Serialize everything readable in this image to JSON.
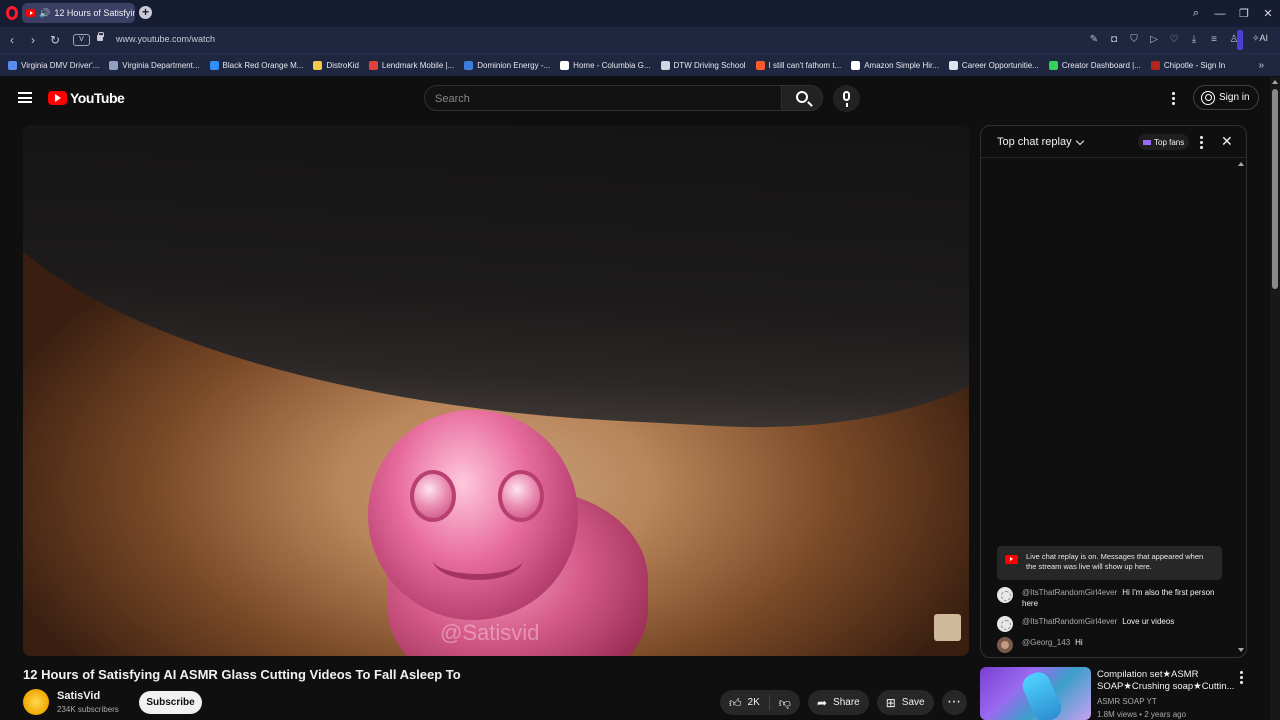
{
  "browser": {
    "tab_title": "12 Hours of Satisfying",
    "tab_audio_icon": "speaker-icon",
    "url": "www.youtube.com/watch",
    "vpn_label": "V",
    "ai_label": "AI",
    "bookmarks": [
      {
        "label": "Virginia DMV Driver'...",
        "color": "#5b8df0"
      },
      {
        "label": "Virginia Department...",
        "color": "#8fa0c0"
      },
      {
        "label": "Black Red Orange M...",
        "color": "#2f8fff"
      },
      {
        "label": "DistroKid",
        "color": "#f2c94c"
      },
      {
        "label": "Lendmark Mobile |...",
        "color": "#e0433b"
      },
      {
        "label": "Dominion Energy -...",
        "color": "#3b7ddd"
      },
      {
        "label": "Home - Columbia G...",
        "color": "#ffffff"
      },
      {
        "label": "DTW Driving School",
        "color": "#cfd6e4"
      },
      {
        "label": "I still can't fathom t...",
        "color": "#ff5a2b"
      },
      {
        "label": "Amazon Simple Hir...",
        "color": "#ffffff"
      },
      {
        "label": "Career Opportunitie...",
        "color": "#dfe3ea"
      },
      {
        "label": "Creator Dashboard |...",
        "color": "#35d05a"
      },
      {
        "label": "Chipotle - Sign In",
        "color": "#b1261d"
      }
    ]
  },
  "youtube": {
    "logo_text": "YouTube",
    "search_placeholder": "Search",
    "sign_in_label": "Sign in"
  },
  "video": {
    "watermark": "@Satisvid",
    "title": "12 Hours of Satisfying AI ASMR Glass Cutting Videos To Fall Asleep To",
    "channel_name": "SatisVid",
    "subscribers": "234K subscribers",
    "subscribe_label": "Subscribe",
    "like_count": "2K",
    "share_label": "Share",
    "save_label": "Save"
  },
  "chat": {
    "title": "Top chat replay",
    "top_fans_label": "Top fans",
    "replay_notice": "Live chat replay is on. Messages that appeared when the stream was live will show up here.",
    "messages": [
      {
        "author": "@ItsThatRandomGirl4ever",
        "text": "Hi I'm also the first person here"
      },
      {
        "author": "@ItsThatRandomGirl4ever",
        "text": "Love ur videos"
      },
      {
        "author": "@Georg_143",
        "text": "Hi"
      }
    ]
  },
  "recommendation": {
    "title": "Compilation set★ASMR SOAP★Crushing soap★Cuttin...",
    "channel": "ASMR SOAP YT",
    "meta": "1.8M views • 2 years ago"
  }
}
